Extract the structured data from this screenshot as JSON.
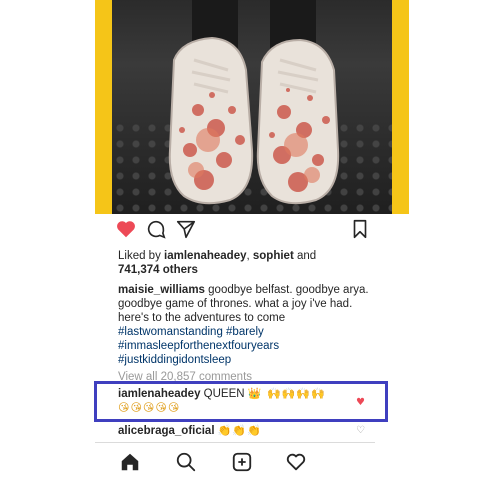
{
  "post": {
    "likes_prefix": "Liked by ",
    "liker_1": "iamlenaheadey",
    "likes_sep": ", ",
    "liker_2": "sophiet",
    "likes_and": " and",
    "likes_count": "741,374 others",
    "author": "maisie_williams",
    "caption_text": " goodbye belfast. goodbye arya. goodbye game of thrones. what a joy i've had. here's to the adventures to come",
    "hashtags": [
      "#lastwomanstanding #barely",
      "#immasleepforthenextfouryears",
      "#justkiddingidontsleep"
    ],
    "view_all": "View all 20,857 comments"
  },
  "comments": [
    {
      "user": "iamlenaheadey",
      "text": " QUEEN ",
      "emoji_line1": "👑 🙌🙌🙌🙌",
      "emoji_line2": "😘😘😘😘😘",
      "liked": true
    },
    {
      "user": "alicebraga_oficial",
      "text": " ",
      "emoji_line1": "👏👏👏",
      "liked": false
    }
  ],
  "colors": {
    "frame": "#f5c518",
    "like_heart": "#ed4956",
    "highlight": "#3f3fbf",
    "hashtag": "#003569"
  },
  "icons": {
    "like": "heart-filled-icon",
    "comment": "comment-bubble-icon",
    "share": "paper-plane-icon",
    "save": "bookmark-icon",
    "home": "home-icon",
    "search": "search-icon",
    "add": "add-post-icon",
    "activity": "heart-outline-icon"
  }
}
